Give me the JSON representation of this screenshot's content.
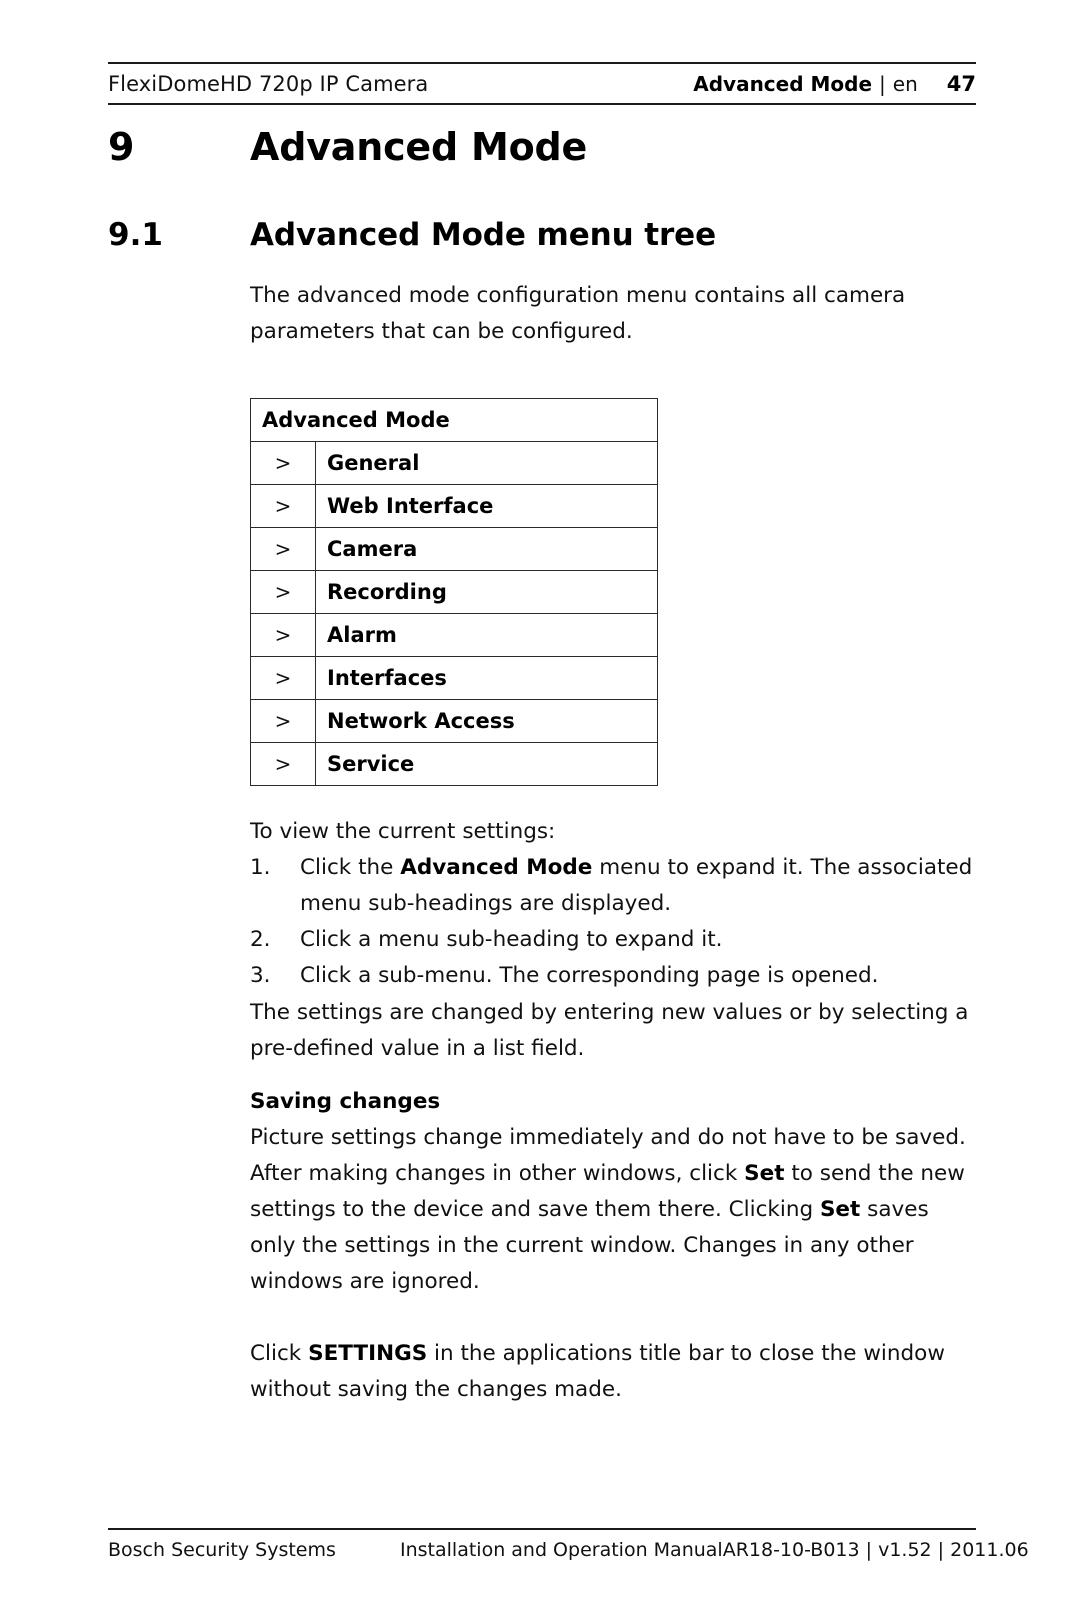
{
  "header": {
    "product": "FlexiDomeHD 720p IP Camera",
    "section": "Advanced Mode",
    "separator": "|",
    "language": "en",
    "page_number": "47"
  },
  "chapter": {
    "number": "9",
    "title": "Advanced Mode"
  },
  "section": {
    "number": "9.1",
    "title": "Advanced Mode menu tree"
  },
  "intro_paragraph": "The advanced mode configuration menu contains all camera parameters that can be configured.",
  "menu_tree": {
    "header_label": "Advanced Mode",
    "arrow_glyph": ">",
    "items": [
      {
        "arrow": ">",
        "label": "General"
      },
      {
        "arrow": ">",
        "label": "Web Interface"
      },
      {
        "arrow": ">",
        "label": "Camera"
      },
      {
        "arrow": ">",
        "label": "Recording"
      },
      {
        "arrow": ">",
        "label": "Alarm"
      },
      {
        "arrow": ">",
        "label": "Interfaces"
      },
      {
        "arrow": ">",
        "label": "Network Access"
      },
      {
        "arrow": ">",
        "label": "Service"
      }
    ]
  },
  "procedure": {
    "lead_in": "To view the current settings:",
    "steps": [
      {
        "number": "1.",
        "text_before": "Click the ",
        "bold": "Advanced Mode",
        "text_after": " menu to expand it. The associated menu sub-headings are displayed."
      },
      {
        "number": "2.",
        "text_before": "Click a menu sub-heading to expand it.",
        "bold": "",
        "text_after": ""
      },
      {
        "number": "3.",
        "text_before": "Click a sub-menu. The corresponding page is opened.",
        "bold": "",
        "text_after": ""
      }
    ],
    "after_list": "The settings are changed by entering new values or by selecting a pre-defined value in a list field."
  },
  "saving_changes": {
    "heading": "Saving changes",
    "body_1": "Picture settings change immediately and do not have to be saved. After making changes in other windows, click ",
    "bold_1": "Set",
    "body_2": " to send the new settings to the device and save them there. Clicking ",
    "bold_2": "Set",
    "body_3": " saves only the settings in the current window. Changes in any other windows are ignored."
  },
  "final_paragraph": {
    "text_before": "Click ",
    "bold": "SETTINGS",
    "text_after": " in the applications title bar to close the window without saving the changes made."
  },
  "footer": {
    "company": "Bosch Security Systems",
    "manual_title": "Installation and Operation Manual",
    "doc_reference": "AR18-10-B013 | v1.52 | 2011.06"
  },
  "colors": {
    "text": "#111111",
    "rule": "#1a1a1a",
    "table_border": "#2b2b2b",
    "background": "#ffffff"
  }
}
